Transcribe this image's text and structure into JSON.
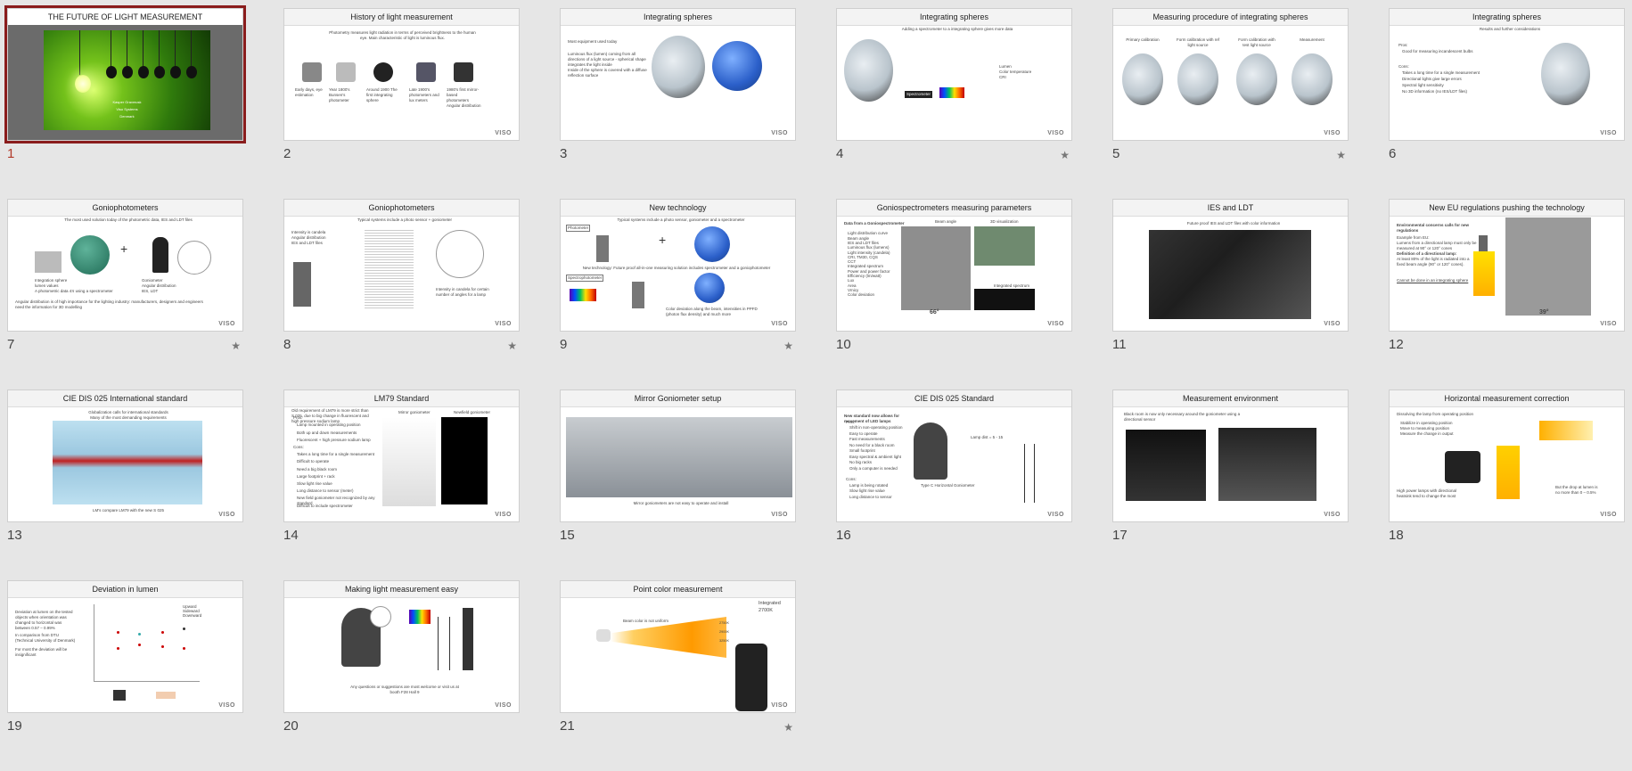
{
  "slides": [
    {
      "number": "1",
      "title": "THE FUTURE OF LIGHT MEASUREMENT",
      "selected": true,
      "star": false,
      "texts": [
        "Kasper Gravmusk",
        "Viso Systems",
        "Denmark"
      ]
    },
    {
      "number": "2",
      "title": "History of light measurement",
      "star": false,
      "texts": [
        "Photometry measures light radiation in terms of perceived brightness to the human eye. Main characteristic of light is luminous flux.",
        "Early days, eye estimation",
        "Year 1800's Bunsen's photometer",
        "Around 1900 The first integrating sphere",
        "Late 1900's photometers and lux meters",
        "1980's first mirror-based photometers",
        "Angular distribution"
      ]
    },
    {
      "number": "3",
      "title": "Integrating spheres",
      "star": false,
      "texts": [
        "Most equipment used today",
        "Luminous flux (lumen) coming from all directions of a light source - spherical shape integrates the light inside",
        "Inside of the sphere is covered with a diffuse reflection surface"
      ]
    },
    {
      "number": "4",
      "title": "Integrating spheres",
      "star": true,
      "texts": [
        "Adding a spectrometer to a integrating sphere gives more data",
        "Spectrometer",
        "Lumen",
        "Color temperature",
        "CRI"
      ]
    },
    {
      "number": "5",
      "title": "Measuring procedure of integrating spheres",
      "star": true,
      "texts": [
        "Primary calibration",
        "Form calibration with ref light source",
        "Form calibration with test light source",
        "Measurement"
      ]
    },
    {
      "number": "6",
      "title": "Integrating spheres",
      "star": false,
      "texts": [
        "Results and further considerations",
        "Pros:",
        "Good for measuring incandescent bulbs",
        "Cons:",
        "Takes a long time for a single measurement",
        "Directional lights give large errors",
        "Spectral light sensitivity",
        "No 3D information (no IES/LDT files)"
      ]
    },
    {
      "number": "7",
      "title": "Goniophotometers",
      "star": true,
      "texts": [
        "The most used solution today of the photometric data, IES and LDT files",
        "Integration sphere",
        "lumen values",
        "A photometric data 4π using a spectrometer",
        "Goniometer",
        "Angular distribution",
        "IES, LDT",
        "Angular distribution is of high importance for the lighting industry: manufacturers, designers and engineers need the information for 3D modelling"
      ]
    },
    {
      "number": "8",
      "title": "Goniophotometers",
      "star": true,
      "texts": [
        "Typical systems include a photo sensor + goniometer",
        "Intensity is candela",
        "Angular distribution",
        "IES and LDT files",
        "Intensity in candela for certain number of angles for a lamp"
      ]
    },
    {
      "number": "9",
      "title": "New technology",
      "star": true,
      "texts": [
        "Typical systems include a photo sensor, goniometer and a spectrometer",
        "Photometer",
        "New technology: Future proof all-in-one measuring solution includes spectrometer and a goniophotometer",
        "Spectrophotometer",
        "Color deviation along the beam, intensities in PPFD (photon flux density) and much more"
      ]
    },
    {
      "number": "10",
      "title": "Goniospectrometers measuring parameters",
      "star": false,
      "texts": [
        "Data from a Goniospectrometer",
        "Light distribution curve",
        "Beam angle",
        "IES and LDT files",
        "Luminous flux (lumens)",
        "Light intensity (candela)",
        "CRI, TM30, CQS",
        "CCT",
        "Integrated spectrum",
        "Power and power factor",
        "Efficiency (lm/watt)",
        "Lux",
        "Area",
        "Vmicy",
        "Color deviation",
        "Beam angle",
        "3D visualization",
        "Integrated spectrum",
        "66°"
      ]
    },
    {
      "number": "11",
      "title": "IES and LDT",
      "star": false,
      "texts": [
        "Future proof IES and LDT files with color information"
      ]
    },
    {
      "number": "12",
      "title": "New EU regulations pushing the technology",
      "star": false,
      "texts": [
        "Environmental concerns calls for new regulations",
        "Example from EU:",
        "Lumens from a directional lamp must only be measured at 90° or 120° cones",
        "Definition of a directional lamp:",
        "At least 80% of the light is radiated into a fixed beam angle (90° or 120° cones).",
        "Cannot be done in an integrating sphere",
        "39°"
      ]
    },
    {
      "number": "13",
      "title": "CIE DIS 025 International standard",
      "star": false,
      "texts": [
        "Globalization calls for international standards",
        "Many of the most demanding requirements",
        "LM's compare LM79 with the new S 025"
      ]
    },
    {
      "number": "14",
      "title": "LM79 Standard",
      "star": false,
      "texts": [
        "Old requirement of LM79 is more strict than S 025, due to big change in fluorescent and high pressure sodium lamp",
        "Pros:",
        "Lamp mounted in operating position",
        "Both up and down measurements",
        "Fluorescent + high pressure sodium lamp",
        "Cons:",
        "Takes a long time for a single measurement",
        "Difficult to operate",
        "Need a big black room",
        "Large footprint + rack",
        "Slow light rise value",
        "Long distance to sensor (meter)",
        "New field goniometer not recognized by any standard",
        "Difficult to include spectrometer",
        "Mirror goniometer",
        "Newfield goniometer"
      ]
    },
    {
      "number": "15",
      "title": "Mirror Goniometer setup",
      "star": false,
      "texts": [
        "Mirror goniometers are not easy to operate and install"
      ]
    },
    {
      "number": "16",
      "title": "CIE DIS 025 Standard",
      "star": false,
      "texts": [
        "New standard now allows for movement of LED lamps",
        "Pros:",
        "Shift in non-operating position",
        "Easy to operate",
        "Fast measurements",
        "No need for a black room",
        "Small footprint",
        "Easy spectral & ambient light",
        "No big racks",
        "Only a computer is needed",
        "Cons:",
        "Lamp is being rotated",
        "Slow light rise value",
        "Long distance to sensor",
        "Lamp dist = 5 - 15",
        "Type C Horizontal Goniometer"
      ]
    },
    {
      "number": "17",
      "title": "Measurement environment",
      "star": false,
      "texts": [
        "Black room is now only necessary around the goniometer using a directional sensor"
      ]
    },
    {
      "number": "18",
      "title": "Horizontal measurement correction",
      "star": false,
      "texts": [
        "Dissolving the lamp from operating position",
        "Stabilize in operating position",
        "Move to measuring position",
        "Measure the change in output",
        "High power lamps with directional heatsink tend to change the most",
        "But the drop at lumen is no more than 0 – 0.5%"
      ]
    },
    {
      "number": "19",
      "title": "Deviation in lumen",
      "star": false,
      "texts": [
        "Deviation at lumen on the tested objects when orientation was changed to horizontal was between 0.57 – 0.99%",
        "In comparison from DTU (Technical University of Denmark)",
        "For most the deviation will be insignificant",
        "Upward",
        "Sideward",
        "Downward"
      ]
    },
    {
      "number": "20",
      "title": "Making light measurement easy",
      "star": false,
      "texts": [
        "Any questions or suggestions are most welcome or visit us at booth F28 Hall 9"
      ]
    },
    {
      "number": "21",
      "title": "Point color measurement",
      "star": true,
      "texts": [
        "Beam color is not uniform",
        "Integrated",
        "2700K",
        "2750K",
        "2900K",
        "3250K"
      ]
    }
  ],
  "brand": {
    "logo": "VISO"
  },
  "colors": {
    "selection": "#8a1c1c",
    "selected_number": "#b23b2a",
    "background": "#e6e6e6"
  }
}
